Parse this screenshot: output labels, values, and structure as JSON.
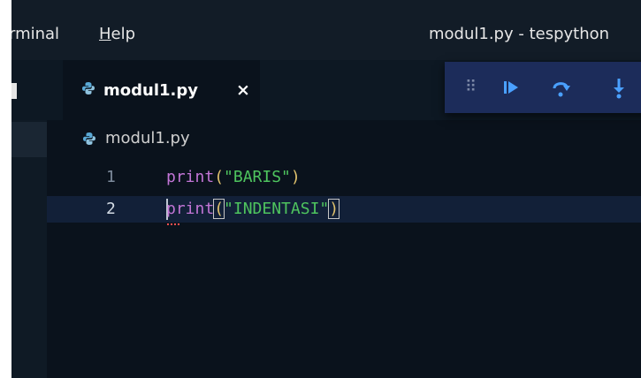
{
  "menu": {
    "terminal_label": "rminal",
    "help_prefix": "H",
    "help_rest": "elp"
  },
  "window_title": "modul1.py - tespython",
  "tabs": [
    {
      "label": "modul1.py",
      "active": true,
      "icon": "python-file-icon",
      "close_glyph": "×"
    }
  ],
  "debug_toolbar": {
    "grip_glyph": "⠿",
    "continue_glyph": "▶",
    "step_over_glyph": "↷",
    "step_into_glyph": "↓"
  },
  "breadcrumb": {
    "icon": "python-file-icon",
    "label": "modul1.py"
  },
  "editor": {
    "lines": [
      {
        "number": "1",
        "keyword": "print",
        "open": "(",
        "string": "\"BARIS\"",
        "close": ")"
      },
      {
        "number": "2",
        "keyword": "print",
        "open": "(",
        "string": "\"INDENTASI\"",
        "close": ")"
      }
    ]
  },
  "colors": {
    "keyword": "#c275d6",
    "string": "#4ec45e",
    "punctuation": "#e0c26d",
    "debug_icon": "#4aa0ff",
    "error_squiggle": "#ff4f4f"
  }
}
